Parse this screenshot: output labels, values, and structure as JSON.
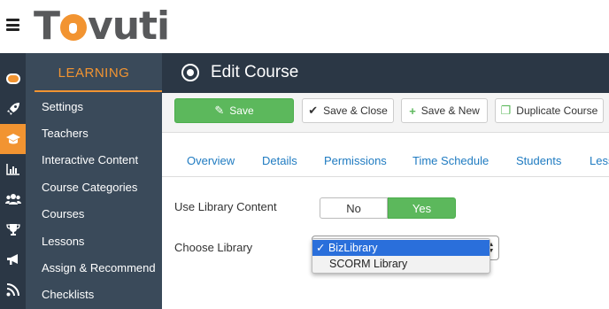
{
  "brand": {
    "logo_text": "Tovuti"
  },
  "sidebar": {
    "title": "LEARNING",
    "items": [
      {
        "label": "Settings"
      },
      {
        "label": "Teachers"
      },
      {
        "label": "Interactive Content"
      },
      {
        "label": "Course Categories"
      },
      {
        "label": "Courses"
      },
      {
        "label": "Lessons"
      },
      {
        "label": "Assign & Recommend"
      },
      {
        "label": "Checklists"
      }
    ]
  },
  "iconbar": {
    "icons": [
      "avatar-icon",
      "rocket-icon",
      "graduation-cap-icon",
      "bar-chart-icon",
      "users-icon",
      "trophy-icon",
      "megaphone-icon",
      "feed-icon"
    ],
    "active": "graduation-cap-icon"
  },
  "header": {
    "title": "Edit Course"
  },
  "toolbar": {
    "save": "Save",
    "save_close": "Save & Close",
    "save_new": "Save & New",
    "duplicate": "Duplicate Course"
  },
  "tabs": [
    "Overview",
    "Details",
    "Permissions",
    "Time Schedule",
    "Students",
    "Less"
  ],
  "form": {
    "use_library_label": "Use Library Content",
    "toggle_no": "No",
    "toggle_yes": "Yes",
    "toggle_value": "Yes",
    "choose_library_label": "Choose Library",
    "library_options": [
      "BizLibrary",
      "SCORM Library"
    ],
    "library_selected": "BizLibrary",
    "check_mark": "✓"
  },
  "colors": {
    "accent": "#f29431",
    "sidebar_dark": "#2b3745",
    "sidebar": "#3a4a5a",
    "green": "#5cb85c",
    "link": "#1f7bc1",
    "select_highlight": "#2a6fdb"
  }
}
